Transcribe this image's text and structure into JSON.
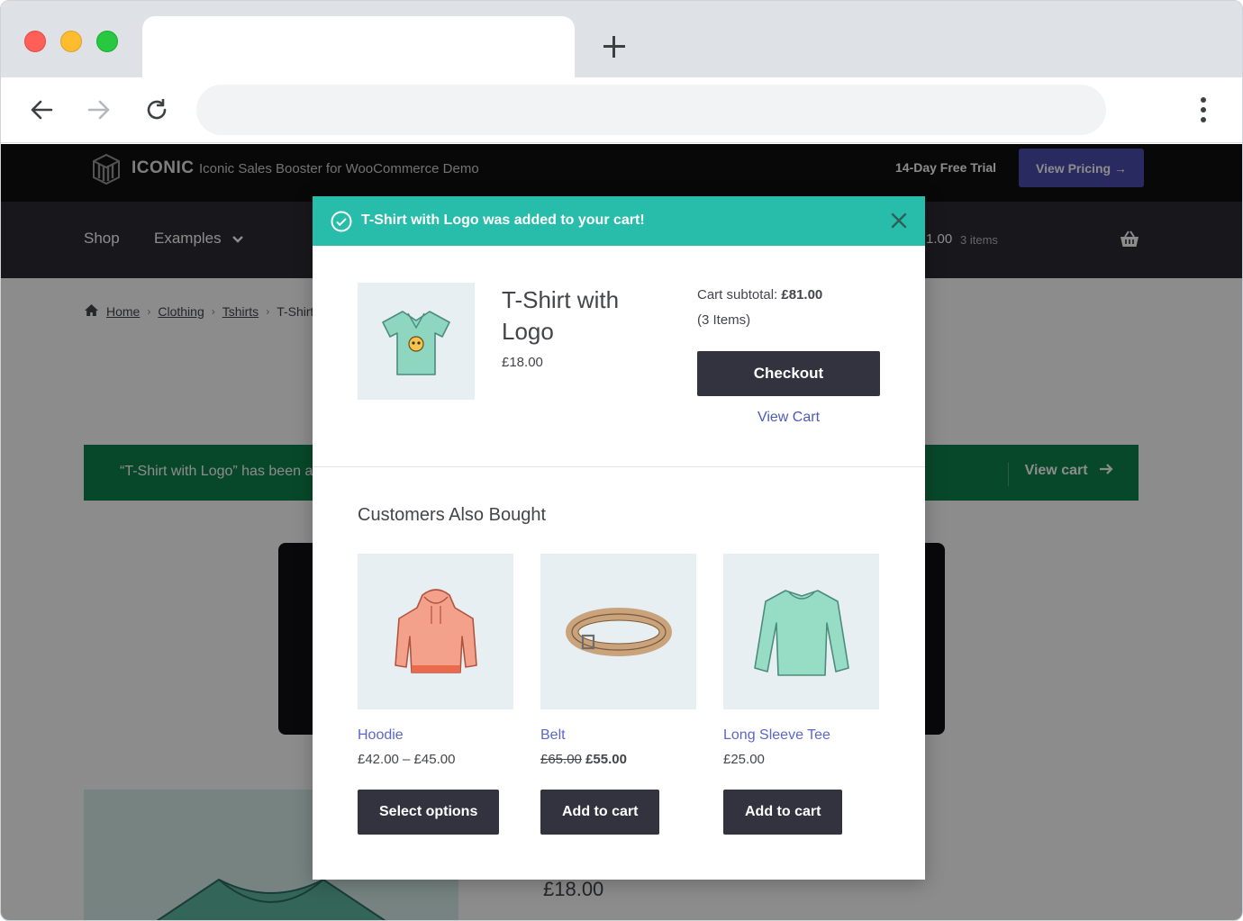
{
  "browser": {
    "tab_title": "",
    "address": ""
  },
  "site": {
    "brand": "ICONIC",
    "subtitle": "Iconic Sales Booster for WooCommerce Demo",
    "trial_link": "14-Day Free Trial",
    "pricing_button": "View Pricing →"
  },
  "nav": {
    "items": [
      "Shop",
      "Examples"
    ],
    "cart_amount": "1.00",
    "cart_count": "3 items"
  },
  "breadcrumb": [
    "Home",
    "Clothing",
    "Tshirts",
    "T-Shirt"
  ],
  "notice": {
    "text": "“T-Shirt with Logo” has been a",
    "link": "View cart"
  },
  "background_price": "£18.00",
  "modal": {
    "header": "T-Shirt with Logo was added to your cart!",
    "product": {
      "name": "T-Shirt with Logo",
      "price": "£18.00"
    },
    "cart": {
      "subtotal_label": "Cart subtotal:",
      "subtotal_value": "£81.00",
      "items": "(3 Items)",
      "checkout": "Checkout",
      "view_cart": "View Cart"
    },
    "also_bought": {
      "title": "Customers Also Bought",
      "products": [
        {
          "name": "Hoodie",
          "price": "£42.00 – £45.00",
          "old_price": "",
          "new_price": "",
          "button": "Select options"
        },
        {
          "name": "Belt",
          "price": "",
          "old_price": "£65.00",
          "new_price": "£55.00",
          "button": "Add to cart"
        },
        {
          "name": "Long Sleeve Tee",
          "price": "£25.00",
          "old_price": "",
          "new_price": "",
          "button": "Add to cart"
        }
      ]
    }
  },
  "colors": {
    "header_teal": "#27bdaa",
    "button_dark": "#333340",
    "link_blue": "#5c67c9",
    "notice_green": "#0f834d",
    "pricing_purple": "#4c4faf"
  }
}
